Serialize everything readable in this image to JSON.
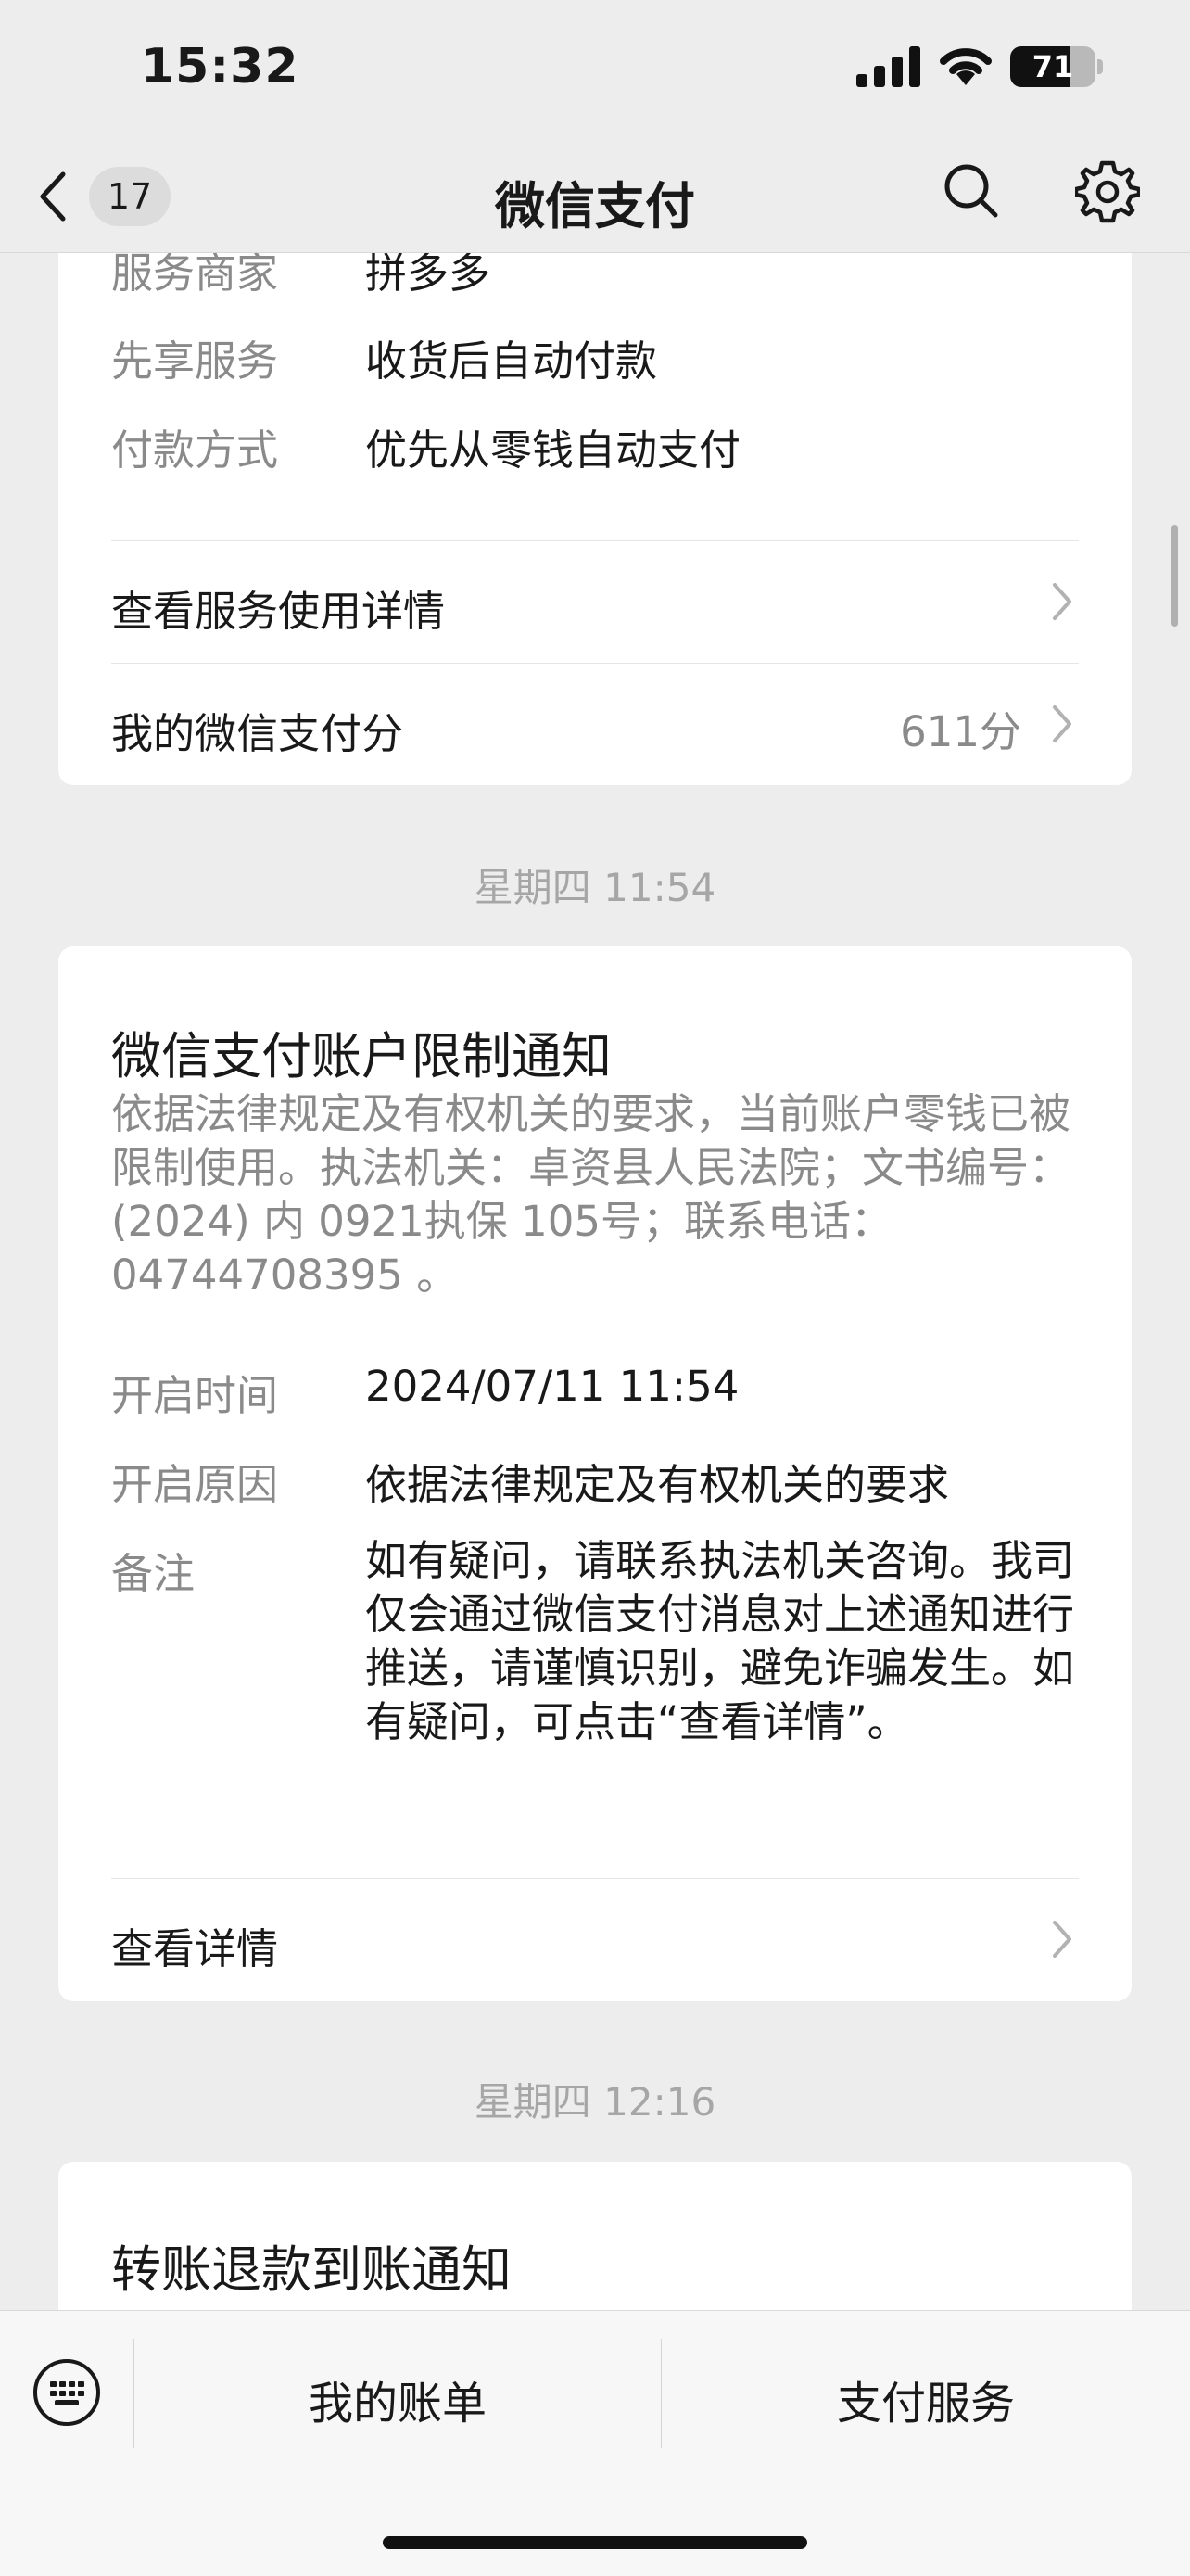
{
  "status_bar": {
    "time": "15:32",
    "battery": "71",
    "battery_level": 0.71
  },
  "nav": {
    "back_count": "17",
    "title": "微信支付",
    "icons": [
      "chevron-left-icon",
      "search-icon",
      "gear-icon"
    ]
  },
  "card1": {
    "rows": [
      {
        "label": "服务商家",
        "value": "拼多多"
      },
      {
        "label": "先享服务",
        "value": "收货后自动付款"
      },
      {
        "label": "付款方式",
        "value": "优先从零钱自动支付"
      }
    ],
    "link_details": "查看服务使用详情",
    "link_score": "我的微信支付分",
    "score_value": "611分"
  },
  "timestamp1": "星期四 11:54",
  "card2": {
    "title": "微信支付账户限制通知",
    "description": "依据法律规定及有权机关的要求，当前账户零钱已被限制使用。执法机关：卓资县人民法院；文书编号：(2024) 内 0921执保 105号；联系电话：04744708395 。",
    "rows": [
      {
        "label": "开启时间",
        "value": "2024/07/11 11:54"
      },
      {
        "label": "开启原因",
        "value": "依据法律规定及有权机关的要求"
      },
      {
        "label": "备注",
        "value": "如有疑问，请联系执法机关咨询。我司仅会通过微信支付消息对上述通知进行推送，请谨慎识别，避免诈骗发生。如有疑问，可点击“查看详情”。"
      }
    ],
    "link_details": "查看详情"
  },
  "timestamp2": "星期四 12:16",
  "card3": {
    "title": "转账退款到账通知"
  },
  "bottom_bar": {
    "tab_bill": "我的账单",
    "tab_services": "支付服务"
  },
  "colors": {
    "background": "#ededed",
    "card": "#ffffff",
    "label_gray": "#8a8a8a",
    "text": "#191919"
  }
}
